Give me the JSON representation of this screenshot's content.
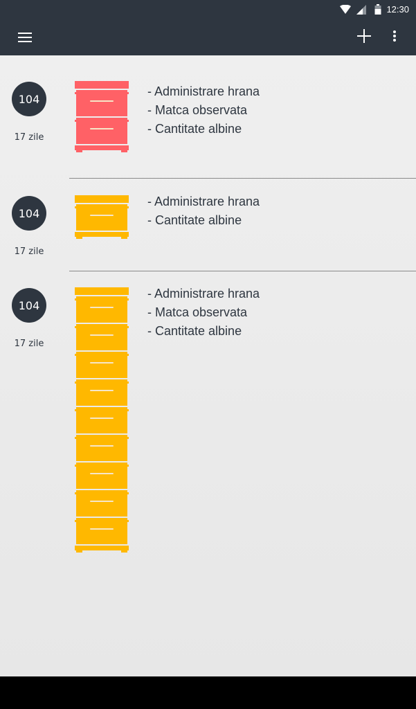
{
  "status_bar": {
    "time": "12:30",
    "icons": [
      "wifi-icon",
      "cell-signal-icon",
      "battery-icon"
    ]
  },
  "toolbar": {
    "menu_icon": "hamburger-menu-icon",
    "add_icon": "plus-icon",
    "overflow_icon": "more-vert-icon",
    "background": "#2e3640"
  },
  "colors": {
    "hive_alert": "#ff6166",
    "hive_normal": "#ffb800",
    "badge": "#2e3640",
    "text": "#2e3640"
  },
  "hives": [
    {
      "number": "104",
      "age": "17 zile",
      "color_key": "hive_alert",
      "boxes": 2,
      "notes": [
        "- Administrare hrana",
        "- Matca observata",
        "- Cantitate albine"
      ]
    },
    {
      "number": "104",
      "age": "17 zile",
      "color_key": "hive_normal",
      "boxes": 1,
      "notes": [
        "- Administrare hrana",
        "- Cantitate albine"
      ]
    },
    {
      "number": "104",
      "age": "17 zile",
      "color_key": "hive_normal",
      "boxes": 9,
      "notes": [
        "- Administrare hrana",
        "- Matca observata",
        "- Cantitate albine"
      ]
    }
  ]
}
